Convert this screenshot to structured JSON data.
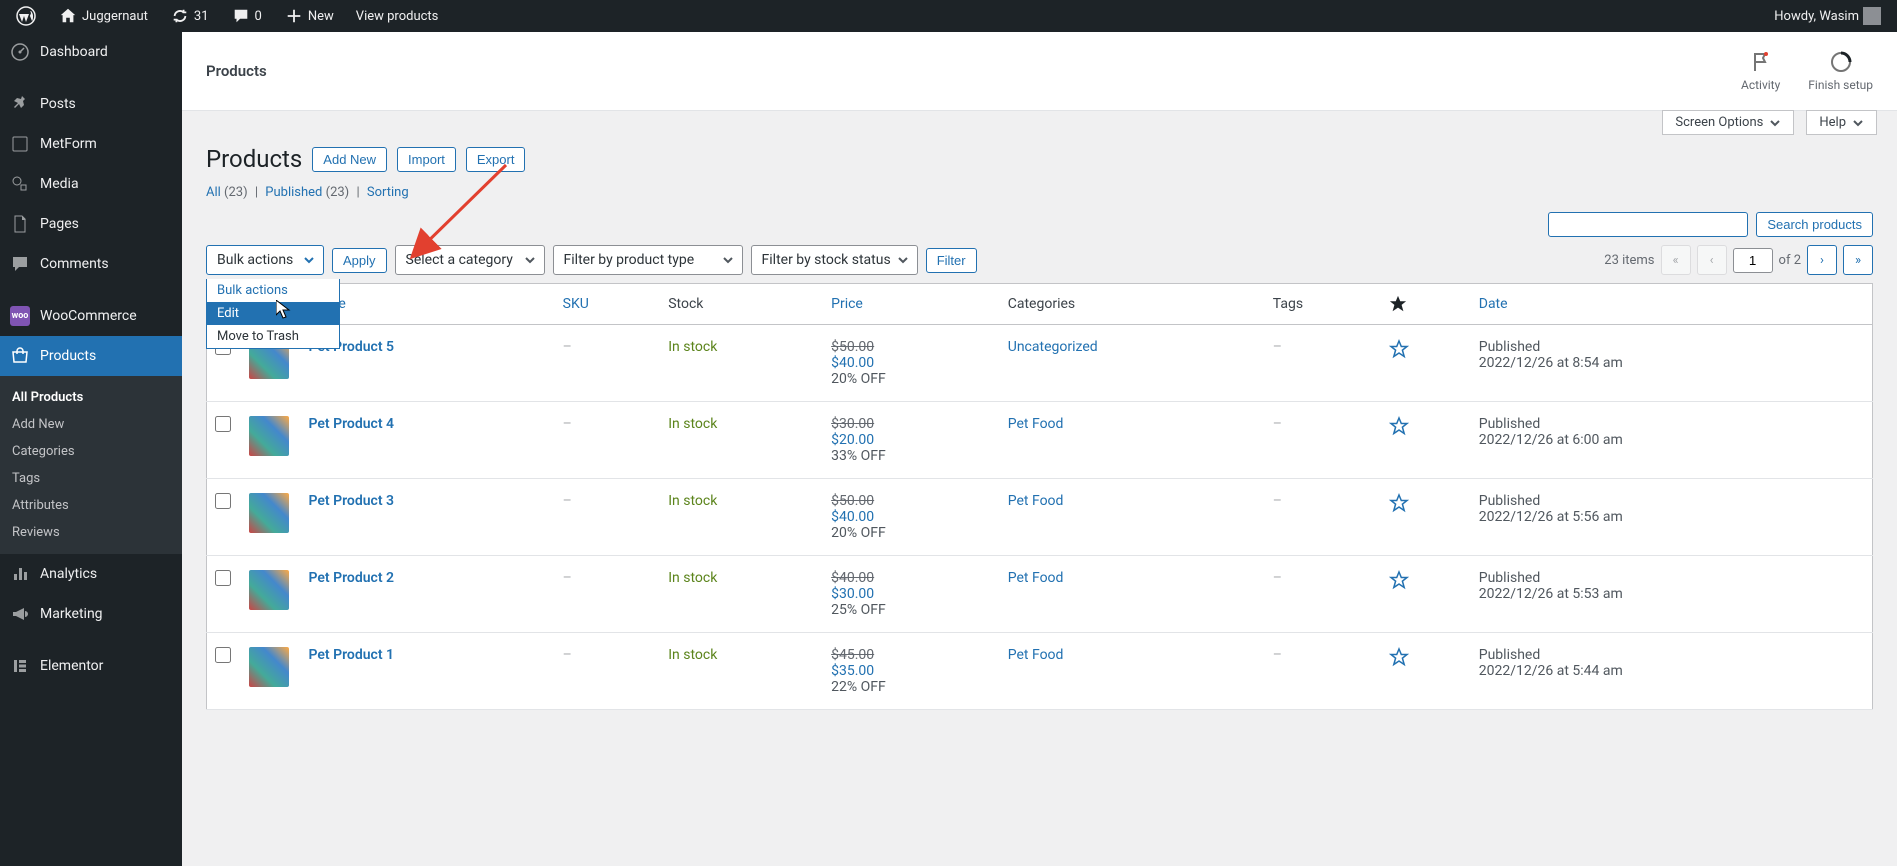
{
  "adminbar": {
    "site_name": "Juggernaut",
    "updates": "31",
    "comments": "0",
    "new_label": "New",
    "view_label": "View products",
    "howdy": "Howdy, Wasim"
  },
  "sidebar": {
    "items": [
      {
        "label": "Dashboard"
      },
      {
        "label": "Posts"
      },
      {
        "label": "MetForm"
      },
      {
        "label": "Media"
      },
      {
        "label": "Pages"
      },
      {
        "label": "Comments"
      },
      {
        "label": "WooCommerce"
      },
      {
        "label": "Products"
      },
      {
        "label": "Analytics"
      },
      {
        "label": "Marketing"
      },
      {
        "label": "Elementor"
      }
    ],
    "sub": [
      {
        "label": "All Products",
        "current": true
      },
      {
        "label": "Add New"
      },
      {
        "label": "Categories"
      },
      {
        "label": "Tags"
      },
      {
        "label": "Attributes"
      },
      {
        "label": "Reviews"
      }
    ]
  },
  "header": {
    "breadcrumb": "Products",
    "activity": "Activity",
    "finish_setup": "Finish setup",
    "screen_options": "Screen Options",
    "help": "Help"
  },
  "page": {
    "title": "Products",
    "add_new": "Add New",
    "import": "Import",
    "export": "Export",
    "filters": {
      "all": "All",
      "all_count": "(23)",
      "published": "Published",
      "published_count": "(23)",
      "sorting": "Sorting"
    },
    "bulk_label": "Bulk actions",
    "bulk_options": [
      "Bulk actions",
      "Edit",
      "Move to Trash"
    ],
    "apply": "Apply",
    "category_sel": "Select a category",
    "type_sel": "Filter by product type",
    "stock_sel": "Filter by stock status",
    "filter": "Filter",
    "search_btn": "Search products",
    "items_count": "23 items",
    "page_current": "1",
    "page_total": "of 2"
  },
  "columns": {
    "name": "Name",
    "sku": "SKU",
    "stock": "Stock",
    "price": "Price",
    "categories": "Categories",
    "tags": "Tags",
    "date": "Date"
  },
  "rows": [
    {
      "name": "Pet Product 5",
      "sku": "–",
      "stock": "In stock",
      "old": "$50.00",
      "new": "$40.00",
      "off": "20% OFF",
      "cat": "Uncategorized",
      "tags": "–",
      "status": "Published",
      "date": "2022/12/26 at 8:54 am"
    },
    {
      "name": "Pet Product 4",
      "sku": "–",
      "stock": "In stock",
      "old": "$30.00",
      "new": "$20.00",
      "off": "33% OFF",
      "cat": "Pet Food",
      "tags": "–",
      "status": "Published",
      "date": "2022/12/26 at 6:00 am"
    },
    {
      "name": "Pet Product 3",
      "sku": "–",
      "stock": "In stock",
      "old": "$50.00",
      "new": "$40.00",
      "off": "20% OFF",
      "cat": "Pet Food",
      "tags": "–",
      "status": "Published",
      "date": "2022/12/26 at 5:56 am"
    },
    {
      "name": "Pet Product 2",
      "sku": "–",
      "stock": "In stock",
      "old": "$40.00",
      "new": "$30.00",
      "off": "25% OFF",
      "cat": "Pet Food",
      "tags": "–",
      "status": "Published",
      "date": "2022/12/26 at 5:53 am"
    },
    {
      "name": "Pet Product 1",
      "sku": "–",
      "stock": "In stock",
      "old": "$45.00",
      "new": "$35.00",
      "off": "22% OFF",
      "cat": "Pet Food",
      "tags": "–",
      "status": "Published",
      "date": "2022/12/26 at 5:44 am"
    }
  ]
}
